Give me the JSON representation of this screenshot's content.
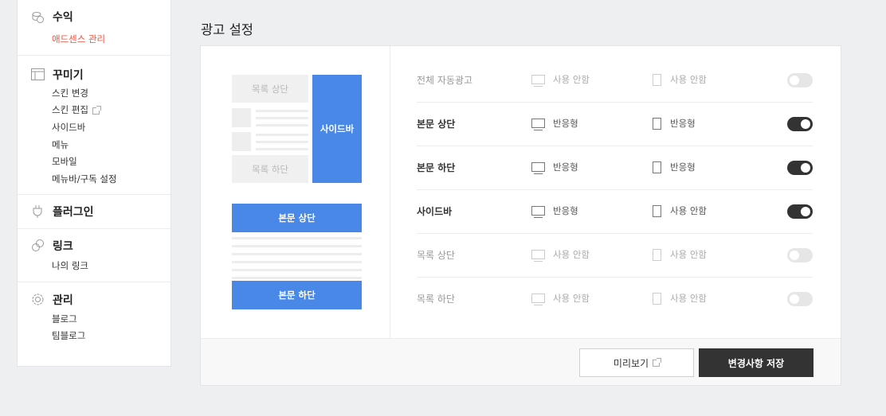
{
  "sidebar": {
    "sections": [
      {
        "title": "수익",
        "icon": "coins-icon",
        "items": [
          {
            "label": "애드센스 관리",
            "active": true
          }
        ]
      },
      {
        "title": "꾸미기",
        "icon": "layout-icon",
        "items": [
          {
            "label": "스킨 변경"
          },
          {
            "label": "스킨 편집",
            "external": true
          },
          {
            "label": "사이드바"
          },
          {
            "label": "메뉴"
          },
          {
            "label": "모바일"
          },
          {
            "label": "메뉴바/구독 설정"
          }
        ]
      },
      {
        "title": "플러그인",
        "icon": "plug-icon",
        "items": []
      },
      {
        "title": "링크",
        "icon": "link-icon",
        "items": [
          {
            "label": "나의 링크"
          }
        ]
      },
      {
        "title": "관리",
        "icon": "gear-icon",
        "items": [
          {
            "label": "블로그"
          },
          {
            "label": "팀블로그"
          }
        ]
      }
    ]
  },
  "page_title": "광고 설정",
  "preview": {
    "list_top": "목록 상단",
    "list_bottom": "목록 하단",
    "sidebar": "사이드바",
    "body_top": "본문 상단",
    "body_bottom": "본문 하단"
  },
  "rows": [
    {
      "label": "전체 자동광고",
      "pc": "사용 안함",
      "mobile": "사용 안함",
      "on": false,
      "dim": true
    },
    {
      "label": "본문 상단",
      "pc": "반응형",
      "mobile": "반응형",
      "on": true,
      "dim": false
    },
    {
      "label": "본문 하단",
      "pc": "반응형",
      "mobile": "반응형",
      "on": true,
      "dim": false
    },
    {
      "label": "사이드바",
      "pc": "반응형",
      "mobile": "사용 안함",
      "on": true,
      "dim": false
    },
    {
      "label": "목록 상단",
      "pc": "사용 안함",
      "mobile": "사용 안함",
      "on": false,
      "dim": true
    },
    {
      "label": "목록 하단",
      "pc": "사용 안함",
      "mobile": "사용 안함",
      "on": false,
      "dim": true
    }
  ],
  "footer": {
    "preview_button": "미리보기",
    "save_button": "변경사항 저장"
  },
  "colors": {
    "accent": "#f0503c",
    "blue": "#4a88e8",
    "dark": "#333333"
  }
}
